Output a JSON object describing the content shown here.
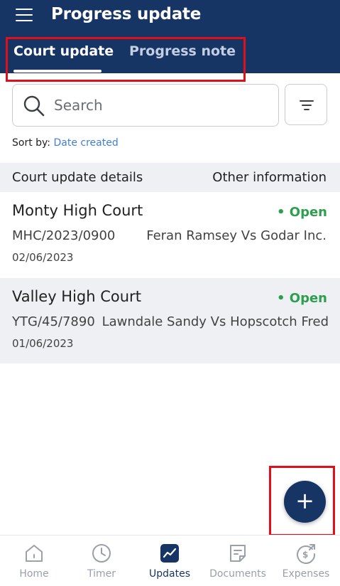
{
  "header": {
    "title": "Progress update",
    "menu_icon": "hamburger-menu-icon",
    "background": "#163464"
  },
  "tabs": [
    {
      "label": "Court update",
      "active": true
    },
    {
      "label": "Progress note",
      "active": false
    }
  ],
  "search": {
    "placeholder": "Search",
    "value": ""
  },
  "sort": {
    "label": "Sort by:",
    "value": "Date created"
  },
  "list_header": {
    "left": "Court update details",
    "right": "Other information"
  },
  "items": [
    {
      "court": "Monty High Court",
      "status": "• Open",
      "case_no": "MHC/2023/0900",
      "parties": "Feran Ramsey Vs Godar Inc.",
      "date": "02/06/2023"
    },
    {
      "court": "Valley High Court",
      "status": "• Open",
      "case_no": "YTG/45/7890",
      "parties": "Lawndale Sandy Vs Hopscotch Fred",
      "date": "01/06/2023"
    }
  ],
  "fab": {
    "symbol": "+",
    "icon": "plus-icon"
  },
  "bottom_nav": [
    {
      "label": "Home",
      "icon": "home-icon",
      "active": false
    },
    {
      "label": "Timer",
      "icon": "clock-icon",
      "active": false
    },
    {
      "label": "Updates",
      "icon": "trend-chart-icon",
      "active": true
    },
    {
      "label": "Documents",
      "icon": "document-icon",
      "active": false
    },
    {
      "label": "Expenses",
      "icon": "dollar-coin-icon",
      "active": false
    }
  ],
  "colors": {
    "primary": "#163464",
    "status_open": "#2e9e4f",
    "link": "#3f7fd6",
    "highlight": "#e0101a",
    "nav_inactive": "#9aa0a8"
  }
}
